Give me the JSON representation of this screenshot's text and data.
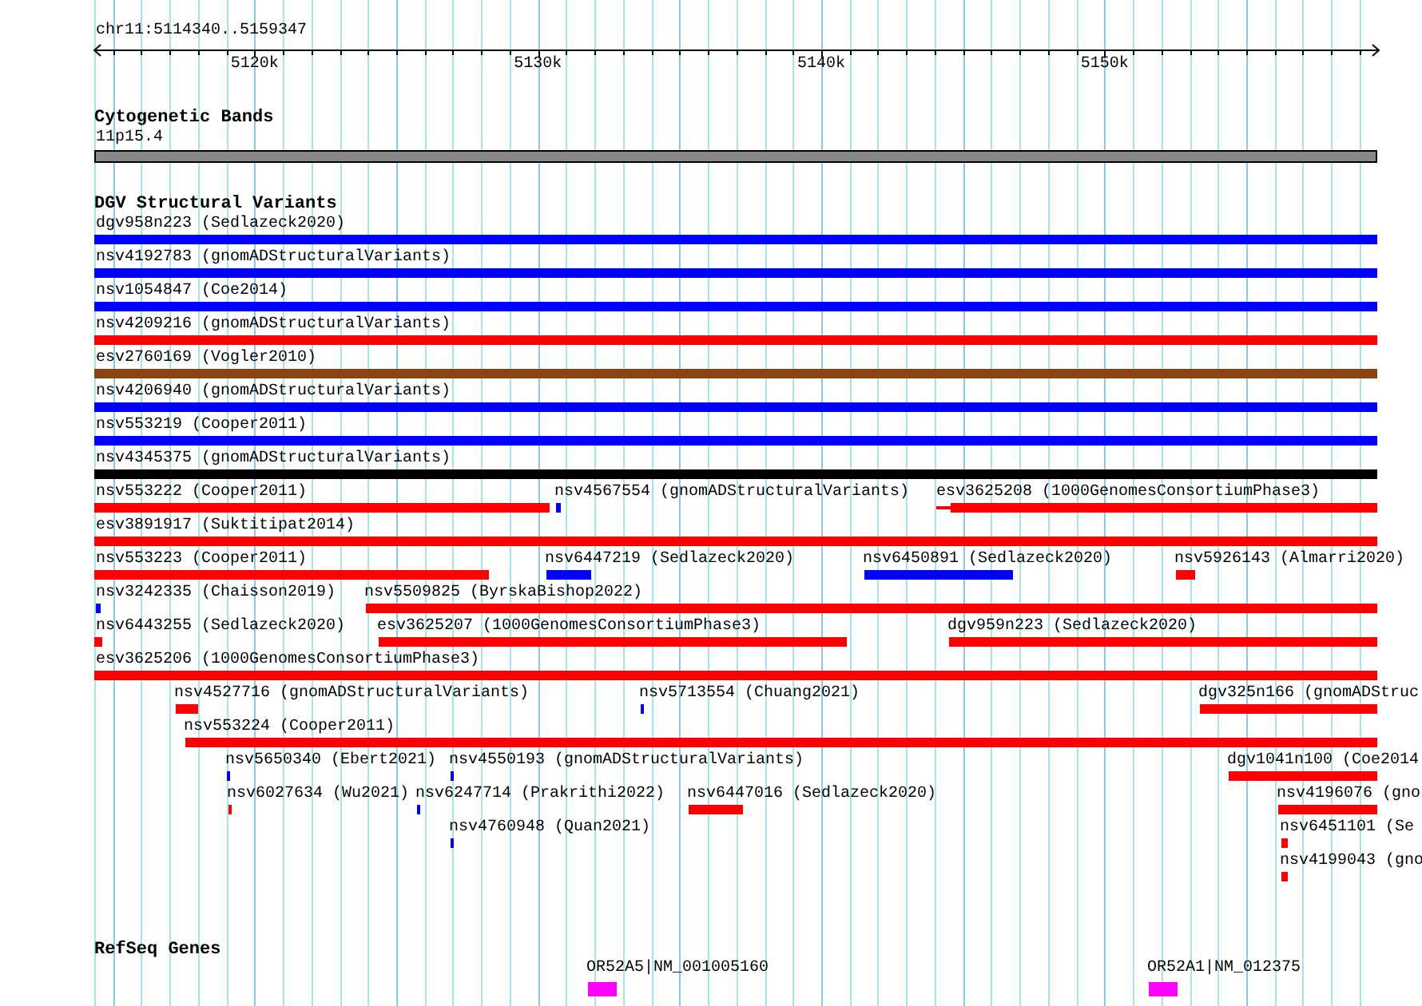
{
  "position": "chr11:5114340..5159347",
  "ruler": {
    "ticks": [
      "5120k",
      "5130k",
      "5140k",
      "5150k"
    ]
  },
  "cytogenetic_bands": {
    "title": "Cytogenetic Bands",
    "band": "11p15.4"
  },
  "dgv": {
    "title": "DGV Structural Variants",
    "lanes": [
      {
        "features": [
          {
            "label": "dgv958n223 (Sedlazeck2020)",
            "color": "#0000ff"
          }
        ]
      },
      {
        "features": [
          {
            "label": "nsv4192783 (gnomADStructuralVariants)",
            "color": "#0000ff"
          }
        ]
      },
      {
        "features": [
          {
            "label": "nsv1054847 (Coe2014)",
            "color": "#0000ff"
          }
        ]
      },
      {
        "features": [
          {
            "label": "nsv4209216 (gnomADStructuralVariants)",
            "color": "#ff0000"
          }
        ]
      },
      {
        "features": [
          {
            "label": "esv2760169 (Vogler2010)",
            "color": "#8b4513"
          }
        ]
      },
      {
        "features": [
          {
            "label": "nsv4206940 (gnomADStructuralVariants)",
            "color": "#0000ff"
          }
        ]
      },
      {
        "features": [
          {
            "label": "nsv553219 (Cooper2011)",
            "color": "#0000ff"
          }
        ]
      },
      {
        "features": [
          {
            "label": "nsv4345375 (gnomADStructuralVariants)",
            "color": "#000000"
          }
        ]
      },
      {
        "features": [
          {
            "label": "nsv553222 (Cooper2011)",
            "color": "#ff0000"
          },
          {
            "label": "nsv4567554 (gnomADStructuralVariants)",
            "color": "#0000ff"
          },
          {
            "label": "esv3625208 (1000GenomesConsortiumPhase3)",
            "color": "#ff0000"
          }
        ]
      },
      {
        "features": [
          {
            "label": "esv3891917 (Suktitipat2014)",
            "color": "#ff0000"
          }
        ]
      },
      {
        "features": [
          {
            "label": "nsv553223 (Cooper2011)",
            "color": "#ff0000"
          },
          {
            "label": "nsv6447219 (Sedlazeck2020)",
            "color": "#0000ff"
          },
          {
            "label": "nsv6450891 (Sedlazeck2020)",
            "color": "#0000ff"
          },
          {
            "label": "nsv5926143 (Almarri2020)",
            "color": "#ff0000"
          }
        ]
      },
      {
        "features": [
          {
            "label": "nsv3242335 (Chaisson2019)",
            "color": "#0000ff"
          },
          {
            "label": "nsv5509825 (ByrskaBishop2022)",
            "color": "#ff0000"
          }
        ]
      },
      {
        "features": [
          {
            "label": "nsv6443255 (Sedlazeck2020)",
            "color": "#ff0000"
          },
          {
            "label": "esv3625207 (1000GenomesConsortiumPhase3)",
            "color": "#ff0000"
          },
          {
            "label": "dgv959n223 (Sedlazeck2020)",
            "color": "#ff0000"
          }
        ]
      },
      {
        "features": [
          {
            "label": "esv3625206 (1000GenomesConsortiumPhase3)",
            "color": "#ff0000"
          }
        ]
      },
      {
        "features": [
          {
            "label": "nsv4527716 (gnomADStructuralVariants)",
            "color": "#ff0000"
          },
          {
            "label": "nsv5713554 (Chuang2021)",
            "color": "#0000ff"
          },
          {
            "label": "dgv325n166 (gnomADStruc",
            "color": "#ff0000"
          }
        ]
      },
      {
        "features": [
          {
            "label": "nsv553224 (Cooper2011)",
            "color": "#ff0000"
          }
        ]
      },
      {
        "features": [
          {
            "label": "nsv5650340 (Ebert2021)",
            "color": "#0000ff"
          },
          {
            "label": "nsv4550193 (gnomADStructuralVariants)",
            "color": "#0000ff"
          },
          {
            "label": "dgv1041n100 (Coe2014",
            "color": "#ff0000"
          }
        ]
      },
      {
        "features": [
          {
            "label": "nsv6027634 (Wu2021)",
            "color": "#ff0000"
          },
          {
            "label": "nsv6247714 (Prakrithi2022)",
            "color": "#0000ff"
          },
          {
            "label": "nsv6447016 (Sedlazeck2020)",
            "color": "#ff0000"
          },
          {
            "label": "nsv4196076 (gno",
            "color": "#ff0000"
          }
        ]
      },
      {
        "features": [
          {
            "label": "nsv4760948 (Quan2021)",
            "color": "#0000ff"
          },
          {
            "label": "nsv6451101 (Se",
            "color": "#ff0000"
          }
        ]
      },
      {
        "features": [
          {
            "label": "nsv4199043 (gno",
            "color": "#ff0000"
          }
        ]
      }
    ]
  },
  "refseq": {
    "title": "RefSeq Genes",
    "genes": [
      {
        "label": "OR52A5|NM_001005160",
        "color": "#ff00ff"
      },
      {
        "label": "OR52A1|NM_012375",
        "color": "#ff00ff"
      }
    ]
  }
}
